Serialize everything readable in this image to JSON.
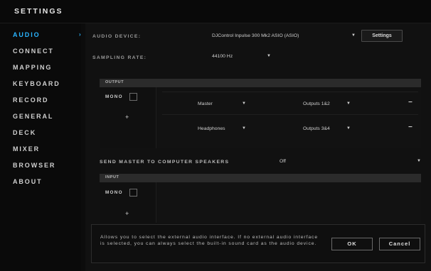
{
  "window": {
    "title": "SETTINGS"
  },
  "sidebar": {
    "items": [
      {
        "label": "AUDIO",
        "active": true
      },
      {
        "label": "CONNECT"
      },
      {
        "label": "MAPPING"
      },
      {
        "label": "KEYBOARD"
      },
      {
        "label": "RECORD"
      },
      {
        "label": "GENERAL"
      },
      {
        "label": "DECK"
      },
      {
        "label": "MIXER"
      },
      {
        "label": "BROWSER"
      },
      {
        "label": "ABOUT"
      }
    ],
    "active_marker": "›"
  },
  "audio": {
    "device_label": "AUDIO DEVICE:",
    "device_value": "DJControl Inpulse 300 Mk2 ASIO (ASIO)",
    "settings_button": "Settings",
    "sampling_label": "SAMPLING RATE:",
    "sampling_value": "44100 Hz"
  },
  "output": {
    "header": "OUTPUT",
    "mono_label": "MONO",
    "add_symbol": "+",
    "rows": [
      {
        "channel": "Master",
        "route": "Outputs 1&2",
        "remove": "−"
      },
      {
        "channel": "Headphones",
        "route": "Outputs 3&4",
        "remove": "−"
      }
    ]
  },
  "send_master": {
    "label": "SEND MASTER TO COMPUTER SPEAKERS",
    "value": "Off"
  },
  "input": {
    "header": "INPUT",
    "mono_label": "MONO",
    "add_symbol": "+"
  },
  "footer": {
    "help_text": "Allows you to select the external audio interface. If no external audio interface is selected, you can always select the built-in sound card as the audio device.",
    "ok_button": "OK",
    "cancel_button": "Cancel"
  },
  "icons": {
    "caret": "▼"
  },
  "colors": {
    "accent": "#2ab4ff",
    "background": "#0c0c0c",
    "panel_header": "#2b2b2b"
  }
}
